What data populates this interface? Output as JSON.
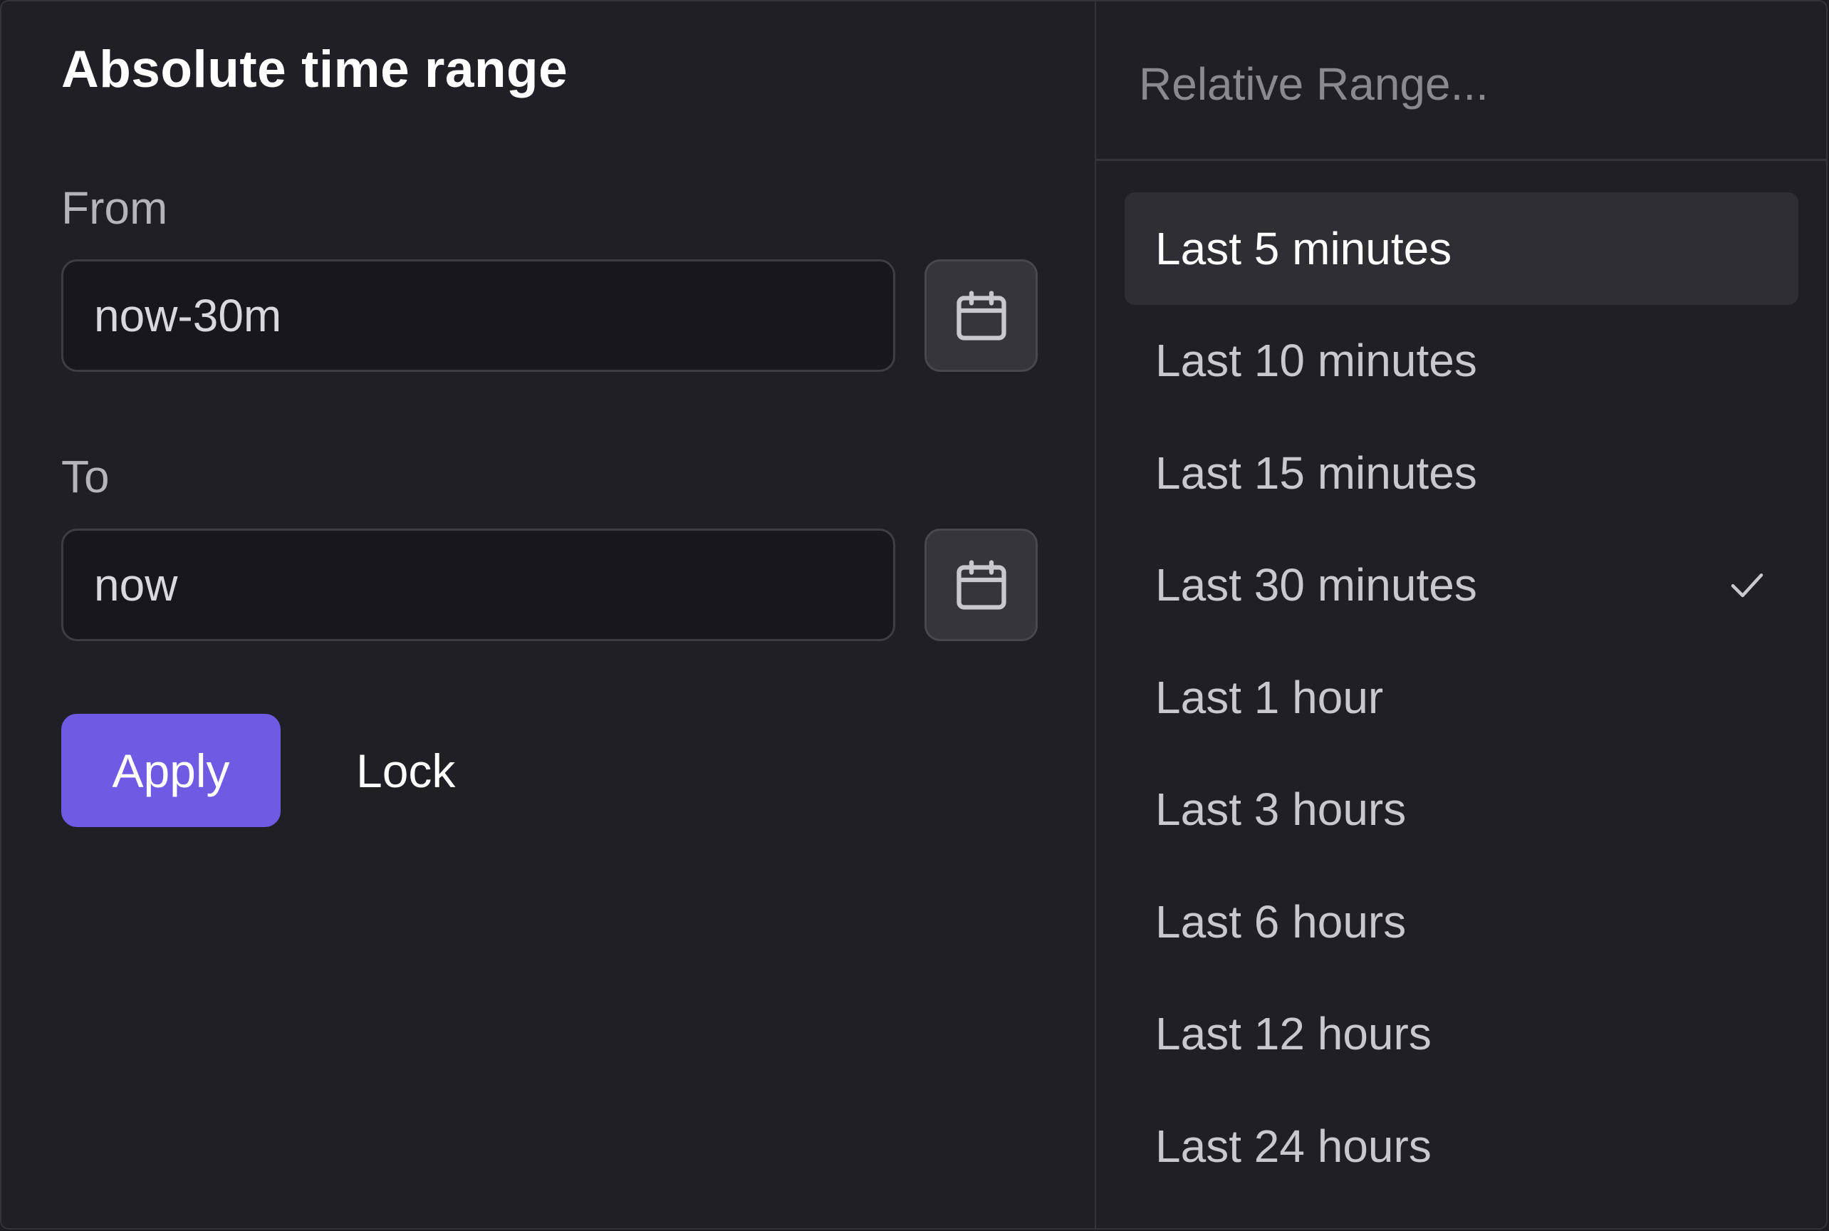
{
  "absolute_panel": {
    "title": "Absolute time range",
    "from": {
      "label": "From",
      "value": "now-30m"
    },
    "to": {
      "label": "To",
      "value": "now"
    },
    "apply_label": "Apply",
    "lock_label": "Lock"
  },
  "relative_panel": {
    "search_placeholder": "Relative Range...",
    "items": [
      {
        "label": "Last 5 minutes",
        "highlighted": true,
        "selected": false
      },
      {
        "label": "Last 10 minutes",
        "highlighted": false,
        "selected": false
      },
      {
        "label": "Last 15 minutes",
        "highlighted": false,
        "selected": false
      },
      {
        "label": "Last 30 minutes",
        "highlighted": false,
        "selected": true
      },
      {
        "label": "Last 1 hour",
        "highlighted": false,
        "selected": false
      },
      {
        "label": "Last 3 hours",
        "highlighted": false,
        "selected": false
      },
      {
        "label": "Last 6 hours",
        "highlighted": false,
        "selected": false
      },
      {
        "label": "Last 12 hours",
        "highlighted": false,
        "selected": false
      },
      {
        "label": "Last 24 hours",
        "highlighted": false,
        "selected": false
      }
    ]
  },
  "icons": {
    "calendar": "calendar-icon",
    "check": "check-icon"
  },
  "colors": {
    "accent": "#6e5ae3",
    "background": "#201f26",
    "input_background": "#18171d",
    "highlight": "#2f2e35"
  }
}
